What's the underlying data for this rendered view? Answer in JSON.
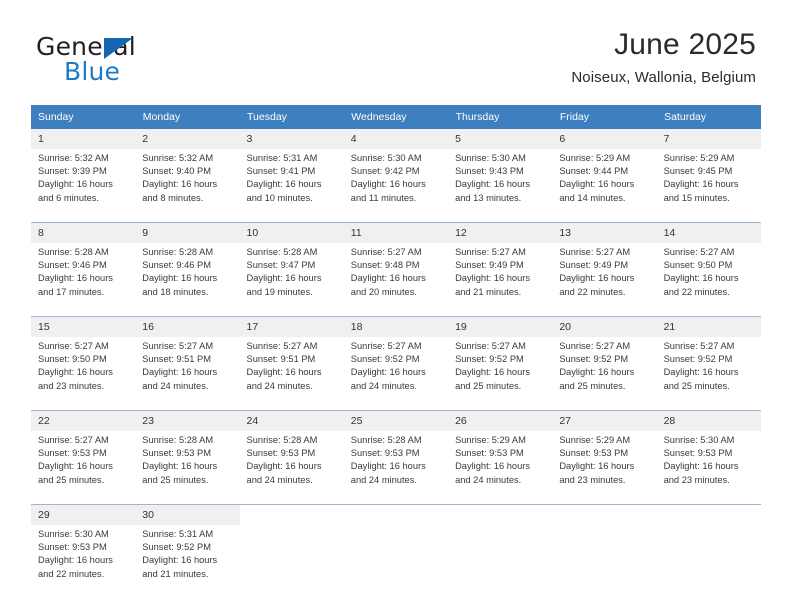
{
  "brand": {
    "name_top": "General",
    "name_bottom": "Blue",
    "triangle_icon": "triangle-icon",
    "color_dark": "#231f20",
    "color_blue": "#1e7ac4"
  },
  "header": {
    "title": "June 2025",
    "subtitle": "Noiseux, Wallonia, Belgium"
  },
  "colors": {
    "header_blue": "#3d7fbf",
    "daynum_band": "#f0f0f0",
    "grid_line": "#9bb7d1",
    "text": "#3a3a3a"
  },
  "weekday_headers": [
    "Sunday",
    "Monday",
    "Tuesday",
    "Wednesday",
    "Thursday",
    "Friday",
    "Saturday"
  ],
  "weeks": [
    [
      {
        "day": "1",
        "sunrise": "Sunrise: 5:32 AM",
        "sunset": "Sunset: 9:39 PM",
        "daylight1": "Daylight: 16 hours",
        "daylight2": "and 6 minutes."
      },
      {
        "day": "2",
        "sunrise": "Sunrise: 5:32 AM",
        "sunset": "Sunset: 9:40 PM",
        "daylight1": "Daylight: 16 hours",
        "daylight2": "and 8 minutes."
      },
      {
        "day": "3",
        "sunrise": "Sunrise: 5:31 AM",
        "sunset": "Sunset: 9:41 PM",
        "daylight1": "Daylight: 16 hours",
        "daylight2": "and 10 minutes."
      },
      {
        "day": "4",
        "sunrise": "Sunrise: 5:30 AM",
        "sunset": "Sunset: 9:42 PM",
        "daylight1": "Daylight: 16 hours",
        "daylight2": "and 11 minutes."
      },
      {
        "day": "5",
        "sunrise": "Sunrise: 5:30 AM",
        "sunset": "Sunset: 9:43 PM",
        "daylight1": "Daylight: 16 hours",
        "daylight2": "and 13 minutes."
      },
      {
        "day": "6",
        "sunrise": "Sunrise: 5:29 AM",
        "sunset": "Sunset: 9:44 PM",
        "daylight1": "Daylight: 16 hours",
        "daylight2": "and 14 minutes."
      },
      {
        "day": "7",
        "sunrise": "Sunrise: 5:29 AM",
        "sunset": "Sunset: 9:45 PM",
        "daylight1": "Daylight: 16 hours",
        "daylight2": "and 15 minutes."
      }
    ],
    [
      {
        "day": "8",
        "sunrise": "Sunrise: 5:28 AM",
        "sunset": "Sunset: 9:46 PM",
        "daylight1": "Daylight: 16 hours",
        "daylight2": "and 17 minutes."
      },
      {
        "day": "9",
        "sunrise": "Sunrise: 5:28 AM",
        "sunset": "Sunset: 9:46 PM",
        "daylight1": "Daylight: 16 hours",
        "daylight2": "and 18 minutes."
      },
      {
        "day": "10",
        "sunrise": "Sunrise: 5:28 AM",
        "sunset": "Sunset: 9:47 PM",
        "daylight1": "Daylight: 16 hours",
        "daylight2": "and 19 minutes."
      },
      {
        "day": "11",
        "sunrise": "Sunrise: 5:27 AM",
        "sunset": "Sunset: 9:48 PM",
        "daylight1": "Daylight: 16 hours",
        "daylight2": "and 20 minutes."
      },
      {
        "day": "12",
        "sunrise": "Sunrise: 5:27 AM",
        "sunset": "Sunset: 9:49 PM",
        "daylight1": "Daylight: 16 hours",
        "daylight2": "and 21 minutes."
      },
      {
        "day": "13",
        "sunrise": "Sunrise: 5:27 AM",
        "sunset": "Sunset: 9:49 PM",
        "daylight1": "Daylight: 16 hours",
        "daylight2": "and 22 minutes."
      },
      {
        "day": "14",
        "sunrise": "Sunrise: 5:27 AM",
        "sunset": "Sunset: 9:50 PM",
        "daylight1": "Daylight: 16 hours",
        "daylight2": "and 22 minutes."
      }
    ],
    [
      {
        "day": "15",
        "sunrise": "Sunrise: 5:27 AM",
        "sunset": "Sunset: 9:50 PM",
        "daylight1": "Daylight: 16 hours",
        "daylight2": "and 23 minutes."
      },
      {
        "day": "16",
        "sunrise": "Sunrise: 5:27 AM",
        "sunset": "Sunset: 9:51 PM",
        "daylight1": "Daylight: 16 hours",
        "daylight2": "and 24 minutes."
      },
      {
        "day": "17",
        "sunrise": "Sunrise: 5:27 AM",
        "sunset": "Sunset: 9:51 PM",
        "daylight1": "Daylight: 16 hours",
        "daylight2": "and 24 minutes."
      },
      {
        "day": "18",
        "sunrise": "Sunrise: 5:27 AM",
        "sunset": "Sunset: 9:52 PM",
        "daylight1": "Daylight: 16 hours",
        "daylight2": "and 24 minutes."
      },
      {
        "day": "19",
        "sunrise": "Sunrise: 5:27 AM",
        "sunset": "Sunset: 9:52 PM",
        "daylight1": "Daylight: 16 hours",
        "daylight2": "and 25 minutes."
      },
      {
        "day": "20",
        "sunrise": "Sunrise: 5:27 AM",
        "sunset": "Sunset: 9:52 PM",
        "daylight1": "Daylight: 16 hours",
        "daylight2": "and 25 minutes."
      },
      {
        "day": "21",
        "sunrise": "Sunrise: 5:27 AM",
        "sunset": "Sunset: 9:52 PM",
        "daylight1": "Daylight: 16 hours",
        "daylight2": "and 25 minutes."
      }
    ],
    [
      {
        "day": "22",
        "sunrise": "Sunrise: 5:27 AM",
        "sunset": "Sunset: 9:53 PM",
        "daylight1": "Daylight: 16 hours",
        "daylight2": "and 25 minutes."
      },
      {
        "day": "23",
        "sunrise": "Sunrise: 5:28 AM",
        "sunset": "Sunset: 9:53 PM",
        "daylight1": "Daylight: 16 hours",
        "daylight2": "and 25 minutes."
      },
      {
        "day": "24",
        "sunrise": "Sunrise: 5:28 AM",
        "sunset": "Sunset: 9:53 PM",
        "daylight1": "Daylight: 16 hours",
        "daylight2": "and 24 minutes."
      },
      {
        "day": "25",
        "sunrise": "Sunrise: 5:28 AM",
        "sunset": "Sunset: 9:53 PM",
        "daylight1": "Daylight: 16 hours",
        "daylight2": "and 24 minutes."
      },
      {
        "day": "26",
        "sunrise": "Sunrise: 5:29 AM",
        "sunset": "Sunset: 9:53 PM",
        "daylight1": "Daylight: 16 hours",
        "daylight2": "and 24 minutes."
      },
      {
        "day": "27",
        "sunrise": "Sunrise: 5:29 AM",
        "sunset": "Sunset: 9:53 PM",
        "daylight1": "Daylight: 16 hours",
        "daylight2": "and 23 minutes."
      },
      {
        "day": "28",
        "sunrise": "Sunrise: 5:30 AM",
        "sunset": "Sunset: 9:53 PM",
        "daylight1": "Daylight: 16 hours",
        "daylight2": "and 23 minutes."
      }
    ],
    [
      {
        "day": "29",
        "sunrise": "Sunrise: 5:30 AM",
        "sunset": "Sunset: 9:53 PM",
        "daylight1": "Daylight: 16 hours",
        "daylight2": "and 22 minutes."
      },
      {
        "day": "30",
        "sunrise": "Sunrise: 5:31 AM",
        "sunset": "Sunset: 9:52 PM",
        "daylight1": "Daylight: 16 hours",
        "daylight2": "and 21 minutes."
      },
      {
        "day": "",
        "sunrise": "",
        "sunset": "",
        "daylight1": "",
        "daylight2": ""
      },
      {
        "day": "",
        "sunrise": "",
        "sunset": "",
        "daylight1": "",
        "daylight2": ""
      },
      {
        "day": "",
        "sunrise": "",
        "sunset": "",
        "daylight1": "",
        "daylight2": ""
      },
      {
        "day": "",
        "sunrise": "",
        "sunset": "",
        "daylight1": "",
        "daylight2": ""
      },
      {
        "day": "",
        "sunrise": "",
        "sunset": "",
        "daylight1": "",
        "daylight2": ""
      }
    ]
  ]
}
